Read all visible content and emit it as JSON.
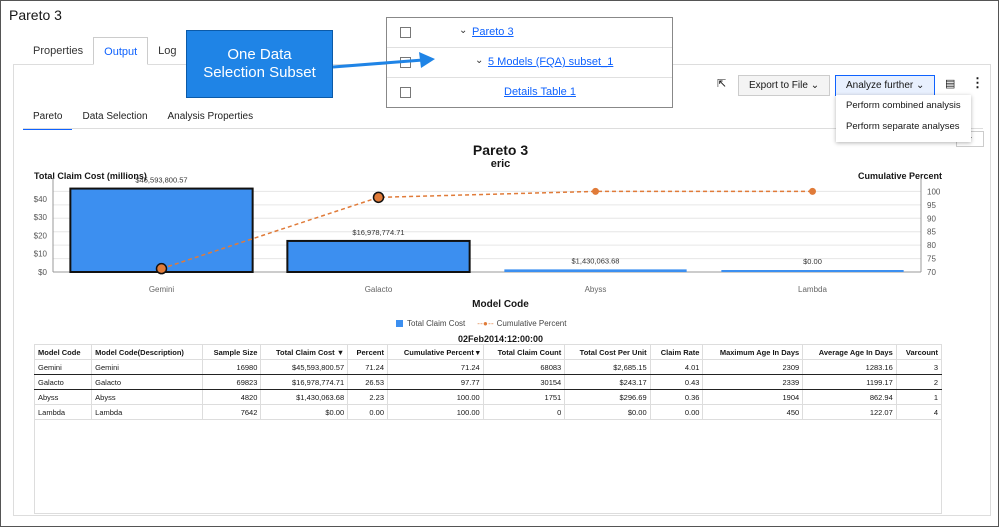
{
  "window": {
    "title": "Pareto 3"
  },
  "tabs": [
    {
      "label": "Properties"
    },
    {
      "label": "Output"
    },
    {
      "label": "Log"
    }
  ],
  "subtabs": [
    {
      "label": "Pareto"
    },
    {
      "label": "Data Selection"
    },
    {
      "label": "Analysis Properties"
    }
  ],
  "callout": {
    "text": "One Data Selection Subset"
  },
  "tree": {
    "rows": [
      {
        "label": "Pareto 3"
      },
      {
        "label": "5 Models (FQA) subset_1"
      },
      {
        "label": "Details Table 1"
      }
    ]
  },
  "toolbar": {
    "export_label": "Export to File",
    "analyze_label": "Analyze further",
    "menu_items": [
      "Perform combined analysis",
      "Perform separate analyses"
    ]
  },
  "chart_data": {
    "type": "bar",
    "title": "Pareto 3",
    "subtitle": "eric",
    "xlabel": "Model Code",
    "ylabel": "Total Claim Cost (millions)",
    "y2label": "Cumulative Percent",
    "categories": [
      "Gemini",
      "Galacto",
      "Abyss",
      "Lambda"
    ],
    "series": [
      {
        "name": "Total Claim Cost",
        "type": "bar",
        "values": [
          45593800.57,
          16978774.71,
          1430063.68,
          0
        ],
        "labels": [
          "$45,593,800.57",
          "$16,978,774.71",
          "$1,430,063.68",
          "$0.00"
        ],
        "color": "#3c8ff0"
      },
      {
        "name": "Cumulative Percent",
        "type": "line",
        "values": [
          71.24,
          97.77,
          100.0,
          100.0
        ],
        "color": "#e07b39"
      }
    ],
    "yticks": [
      "$0",
      "$10",
      "$20",
      "$30",
      "$40"
    ],
    "ylim": [
      0,
      47
    ],
    "y2ticks": [
      "70",
      "75",
      "80",
      "85",
      "90",
      "95",
      "100"
    ],
    "y2lim": [
      70,
      102
    ],
    "legend": "bottom"
  },
  "table": {
    "timestamp": "02Feb2014:12:00:00",
    "columns": [
      "Model Code",
      "Model Code(Description)",
      "Sample Size",
      "Total Claim Cost ▼",
      "Percent",
      "Cumulative Percent ▾",
      "Total Claim Count",
      "Total Cost Per Unit",
      "Claim Rate",
      "Maximum Age In Days",
      "Average Age In Days",
      "Varcount"
    ],
    "rows": [
      [
        "Gemini",
        "Gemini",
        "16980",
        "$45,593,800.57",
        "71.24",
        "71.24",
        "68083",
        "$2,685.15",
        "4.01",
        "2309",
        "1283.16",
        "3"
      ],
      [
        "Galacto",
        "Galacto",
        "69823",
        "$16,978,774.71",
        "26.53",
        "97.77",
        "30154",
        "$243.17",
        "0.43",
        "2339",
        "1199.17",
        "2"
      ],
      [
        "Abyss",
        "Abyss",
        "4820",
        "$1,430,063.68",
        "2.23",
        "100.00",
        "1751",
        "$296.69",
        "0.36",
        "1904",
        "862.94",
        "1"
      ],
      [
        "Lambda",
        "Lambda",
        "7642",
        "$0.00",
        "0.00",
        "100.00",
        "0",
        "$0.00",
        "0.00",
        "450",
        "122.07",
        "4"
      ]
    ]
  }
}
